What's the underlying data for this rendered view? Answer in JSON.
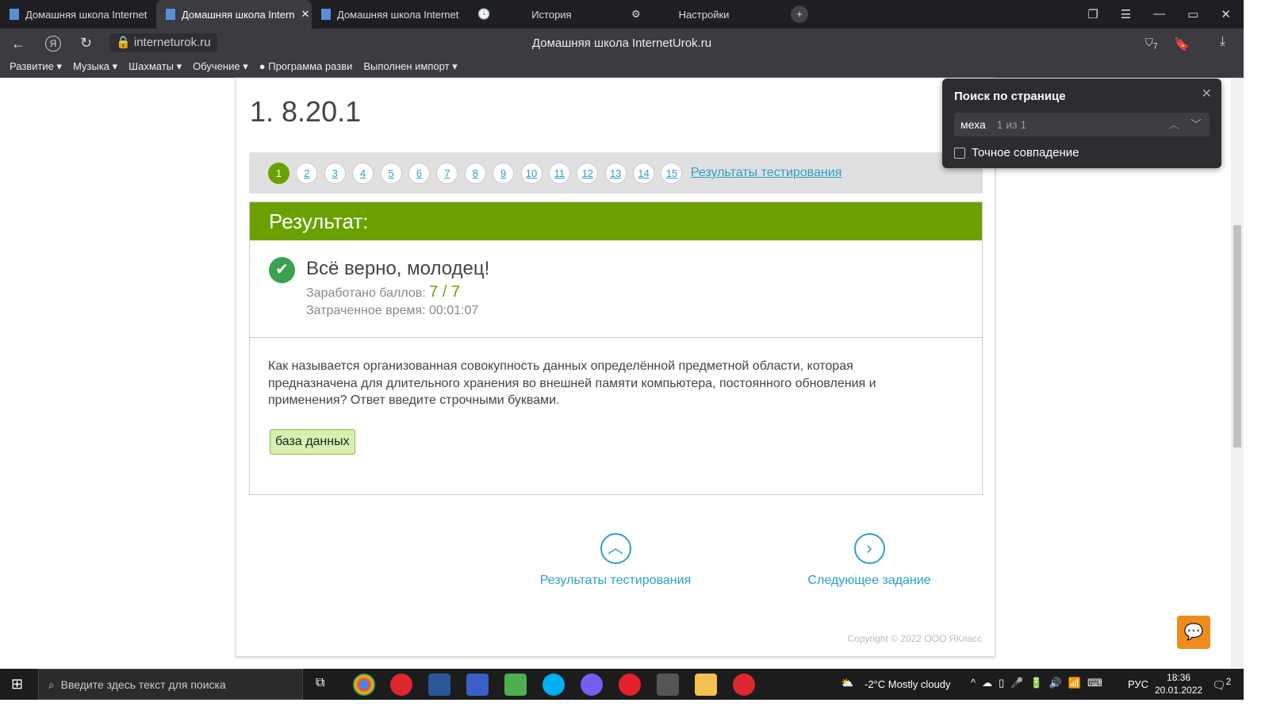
{
  "tabs": [
    {
      "label": "Домашняя школа Internet"
    },
    {
      "label": "Домашняя школа Intern"
    },
    {
      "label": "Домашняя школа Internet"
    },
    {
      "label": "История"
    },
    {
      "label": "Настройки"
    }
  ],
  "address": "interneturok.ru",
  "page_title": "Домашняя школа InternetUrok.ru",
  "downloads_badge": "7",
  "bookmarks": [
    "Развитие ▾",
    "Музыка ▾",
    "Шахматы ▾",
    "Обучение ▾",
    "Программа разви",
    "Выполнен импорт ▾"
  ],
  "heading": "1. 8.20.1",
  "pages": [
    "1",
    "2",
    "3",
    "4",
    "5",
    "6",
    "7",
    "8",
    "9",
    "10",
    "11",
    "12",
    "13",
    "14",
    "15"
  ],
  "results_link": "Результаты тестирования",
  "result_header": "Результат:",
  "verdict": "Всё верно, молодец!",
  "score_label": "Заработано баллов:",
  "score": "7 / 7",
  "time_label": "Затраченное время: 00:01:07",
  "question": "Как называется организованная совокупность данных определённой предметной области, которая предназначена для длительного хранения во внешней памяти компьютера, постоянного обновления и применения? Ответ введите строчными буквами.",
  "answer": "база данных",
  "nav_results": "Результаты тестирования",
  "nav_next": "Следующее задание",
  "copyright": "Copyright © 2022 ООО ЯКласс",
  "find": {
    "title": "Поиск по странице",
    "query": "меха",
    "count": "1 из 1",
    "exact": "Точное совпадение"
  },
  "taskbar": {
    "search_placeholder": "Введите здесь текст для поиска",
    "weather": "-2°C  Mostly cloudy",
    "lang": "РУС",
    "time": "18:36",
    "date": "20.01.2022",
    "notif": "2"
  }
}
